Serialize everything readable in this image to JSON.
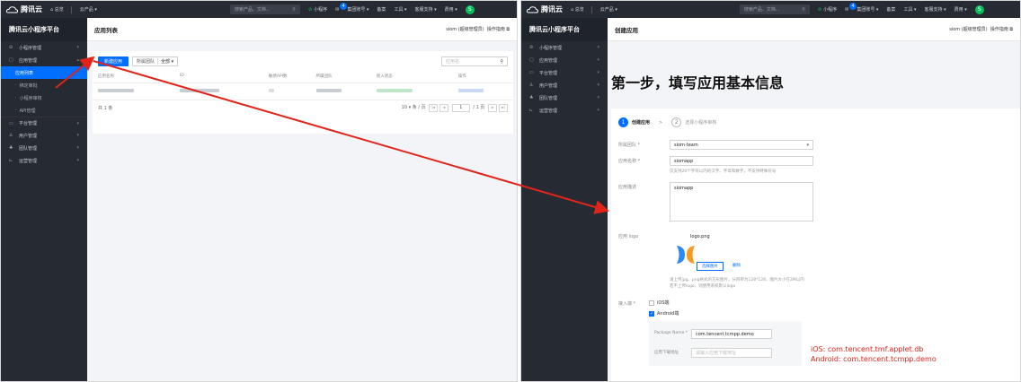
{
  "topbar": {
    "logo": "腾讯云",
    "home": "总览",
    "products": "云产品 ▾",
    "search_placeholder": "搜索产品、文档...",
    "mini": "小程序",
    "msg_count": "4",
    "account": "集团账号 ▾",
    "filing": "备案",
    "tools": "工具 ▾",
    "support": "客服支持 ▾",
    "billing": "费用 ▾",
    "avatar": "S"
  },
  "sidebar": {
    "brand": "腾讯云小程序平台",
    "left_items": [
      {
        "icon": "⊘",
        "label": "小程序管理",
        "chev": "▾"
      },
      {
        "icon": "▢",
        "label": "应用管理",
        "chev": "▴"
      },
      {
        "label": "应用列表"
      },
      {
        "label": "绑定审批"
      },
      {
        "label": "小程序审核"
      },
      {
        "label": "API管理"
      },
      {
        "icon": "▭",
        "label": "平台管理",
        "chev": "▾"
      },
      {
        "icon": "♙",
        "label": "用户管理",
        "chev": "▾"
      },
      {
        "icon": "♣",
        "label": "团队管理",
        "chev": "▾"
      },
      {
        "icon": "⊾",
        "label": "运营管理",
        "chev": "▾"
      }
    ],
    "right_items": [
      {
        "icon": "⊘",
        "label": "小程序管理",
        "chev": "▾"
      },
      {
        "icon": "▢",
        "label": "应用管理",
        "chev": "▾"
      },
      {
        "icon": "▭",
        "label": "平台管理",
        "chev": "▾"
      },
      {
        "icon": "♙",
        "label": "用户管理",
        "chev": "▾"
      },
      {
        "icon": "♣",
        "label": "团队管理",
        "chev": "▾"
      },
      {
        "icon": "⊾",
        "label": "运营管理",
        "chev": "▾"
      }
    ]
  },
  "left": {
    "page_title": "应用列表",
    "user": "siom (超级管理员)",
    "guide": "操作指南 ⧉",
    "create_button": "新建应用",
    "team_label": "所属团队",
    "team_value": "全部 ▾",
    "search_placeholder": "应用名",
    "columns": [
      "应用名称",
      "ID",
      "敏感API数",
      "所属团队",
      "接入状态",
      "操作"
    ],
    "total": "共 1 条",
    "page_size": "10 ▾ 条 / 页",
    "page_num": "1",
    "page_total": "/ 1 页"
  },
  "right": {
    "page_title": "创建应用",
    "user": "siom (超级管理员)",
    "guide": "操作指南 ⧉",
    "heading": "第一步，填写应用基本信息",
    "step1_num": "1",
    "step1_label": "创建应用",
    "step2_num": "2",
    "step2_label": "选择小程序审核",
    "team_label": "所属团队 *",
    "team_value": "siom-team",
    "name_label": "应用名称 *",
    "name_value": "siomapp",
    "name_hint": "仅支持20个字符以内的汉字、字母和数字，不支持特殊符号",
    "desc_label": "应用描述",
    "desc_value": "siomapp",
    "logo_label": "应用 logo",
    "logo_file": "logo.png",
    "choose_image": "选择图片",
    "delete": "删除",
    "logo_hint1": "请上传jpg、png格式的方形图片，分辨率为128*128，图片大小在2M以内",
    "logo_hint2": "若不上传logo，则使用系统默认logo",
    "platform_label": "接入端 *",
    "ios_label": "iOS端",
    "android_label": "Android端",
    "pkg_label": "Package Name *",
    "pkg_value": "com.tencent.tcmpp.demo",
    "download_label": "应用下载地址",
    "download_placeholder": "请输入应用下载地址",
    "note_ios": "iOS: com.tencent.tmf.applet.db",
    "note_android": "Android: com.tencent.tcmpp.demo"
  },
  "colors": {
    "accent": "#006eff",
    "annotation": "#e2231a"
  }
}
